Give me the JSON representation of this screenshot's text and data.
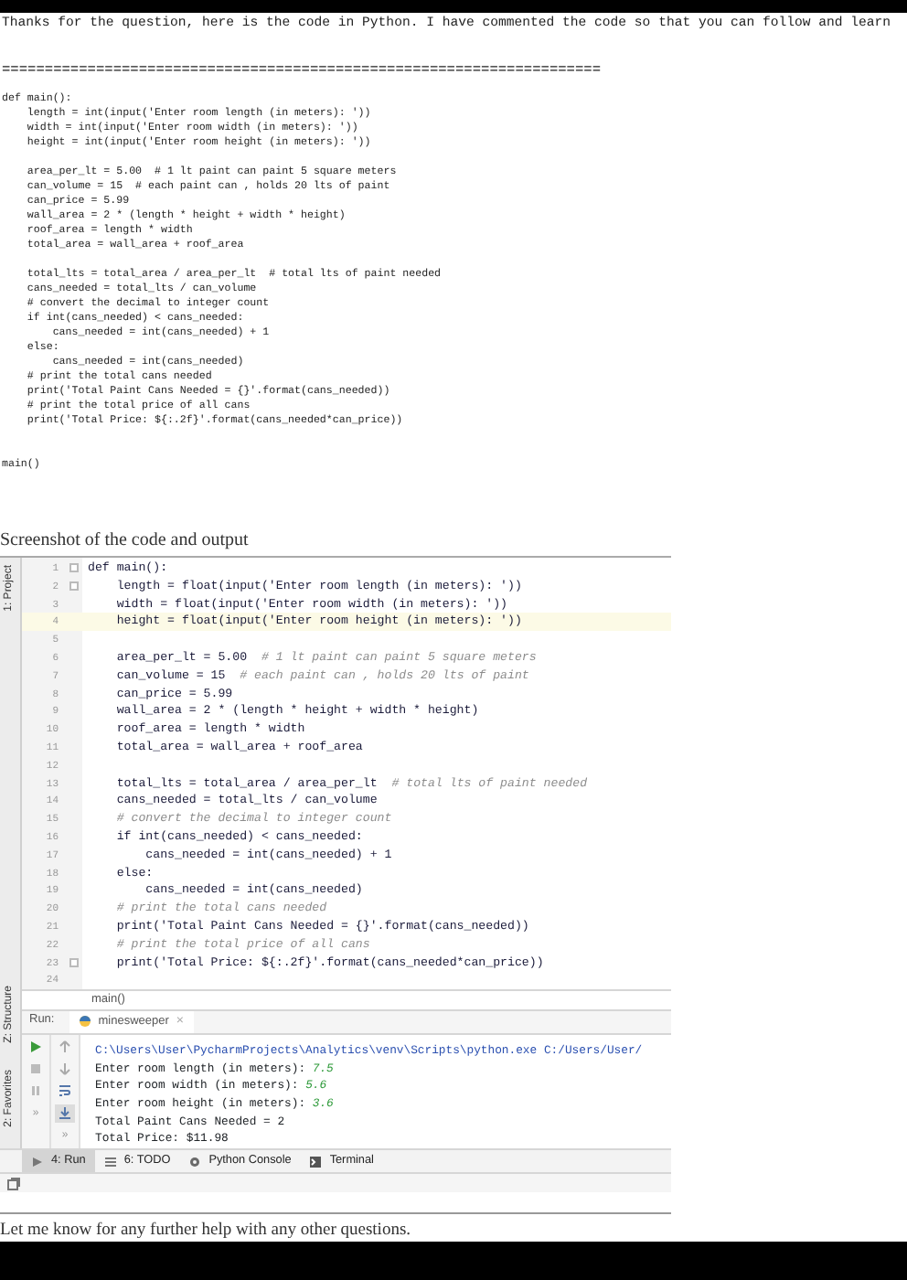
{
  "answer": {
    "intro": "Thanks for the question, here is the code in Python. I have commented the code so that you can follow and learn",
    "separator": "======================================================================",
    "code": "def main():\n    length = int(input('Enter room length (in meters): '))\n    width = int(input('Enter room width (in meters): '))\n    height = int(input('Enter room height (in meters): '))\n\n    area_per_lt = 5.00  # 1 lt paint can paint 5 square meters\n    can_volume = 15  # each paint can , holds 20 lts of paint\n    can_price = 5.99\n    wall_area = 2 * (length * height + width * height)\n    roof_area = length * width\n    total_area = wall_area + roof_area\n\n    total_lts = total_area / area_per_lt  # total lts of paint needed\n    cans_needed = total_lts / can_volume\n    # convert the decimal to integer count\n    if int(cans_needed) < cans_needed:\n        cans_needed = int(cans_needed) + 1\n    else:\n        cans_needed = int(cans_needed)\n    # print the total cans needed\n    print('Total Paint Cans Needed = {}'.format(cans_needed))\n    # print the total price of all cans\n    print('Total Price: ${:.2f}'.format(cans_needed*can_price))",
    "call": "main()"
  },
  "caption": "Screenshot of the code and output",
  "ide": {
    "tool_windows": [
      {
        "label": "1: Project",
        "kind": "top"
      },
      {
        "label": "Z: Structure",
        "kind": "bottom"
      },
      {
        "label": "2: Favorites",
        "kind": "bottom"
      }
    ],
    "editor": {
      "lines": [
        {
          "number": "1",
          "code": "def main():",
          "fold": true,
          "current": false
        },
        {
          "number": "2",
          "code": "    length = float(input('Enter room length (in meters): '))",
          "fold": true,
          "current": false
        },
        {
          "number": "3",
          "code": "    width = float(input('Enter room width (in meters): '))",
          "fold": false,
          "current": false
        },
        {
          "number": "4",
          "code": "    height = float(input('Enter room height (in meters): '))",
          "fold": false,
          "current": true
        },
        {
          "number": "5",
          "fold": false,
          "current": false
        },
        {
          "number": "6",
          "code": "    area_per_lt = 5.00  ",
          "comment": "# 1 lt paint can paint 5 square meters",
          "fold": false,
          "current": false
        },
        {
          "number": "7",
          "code": "    can_volume = 15  ",
          "comment": "# each paint can , holds 20 lts of paint",
          "fold": false,
          "current": false
        },
        {
          "number": "8",
          "code": "    can_price = 5.99",
          "fold": false,
          "current": false
        },
        {
          "number": "9",
          "code": "    wall_area = 2 * (length * height + width * height)",
          "fold": false,
          "current": false
        },
        {
          "number": "10",
          "code": "    roof_area = length * width",
          "fold": false,
          "current": false
        },
        {
          "number": "11",
          "code": "    total_area = wall_area + roof_area",
          "fold": false,
          "current": false
        },
        {
          "number": "12",
          "fold": false,
          "current": false
        },
        {
          "number": "13",
          "code": "    total_lts = total_area / area_per_lt  ",
          "comment": "# total lts of paint needed",
          "fold": false,
          "current": false
        },
        {
          "number": "14",
          "code": "    cans_needed = total_lts / can_volume",
          "fold": false,
          "current": false
        },
        {
          "number": "15",
          "comment": "    # convert the decimal to integer count",
          "fold": false,
          "current": false
        },
        {
          "number": "16",
          "code": "    if int(cans_needed) < cans_needed:",
          "fold": false,
          "current": false
        },
        {
          "number": "17",
          "code": "        cans_needed = int(cans_needed) + 1",
          "fold": false,
          "current": false
        },
        {
          "number": "18",
          "code": "    else:",
          "fold": false,
          "current": false
        },
        {
          "number": "19",
          "code": "        cans_needed = int(cans_needed)",
          "fold": false,
          "current": false
        },
        {
          "number": "20",
          "comment": "    # print the total cans needed",
          "fold": false,
          "current": false
        },
        {
          "number": "21",
          "code": "    print('Total Paint Cans Needed = {}'.format(cans_needed))",
          "fold": false,
          "current": false
        },
        {
          "number": "22",
          "comment": "    # print the total price of all cans",
          "fold": false,
          "current": false
        },
        {
          "number": "23",
          "code": "    print('Total Price: ${:.2f}'.format(cans_needed*can_price))",
          "fold": true,
          "current": false
        },
        {
          "number": "24",
          "fold": false,
          "current": false
        }
      ],
      "breadcrumb": "main()"
    },
    "run": {
      "label": "Run:",
      "tab": "minesweeper",
      "close": "×",
      "more": [
        "»",
        "»"
      ],
      "output": [
        {
          "kind": "command",
          "text": "C:\\Users\\User\\PycharmProjects\\Analytics\\venv\\Scripts\\python.exe C:/Users/User/"
        },
        {
          "kind": "prompt",
          "text": "Enter room length (in meters): ",
          "input": "7.5"
        },
        {
          "kind": "prompt",
          "text": "Enter room width (in meters): ",
          "input": "5.6"
        },
        {
          "kind": "prompt",
          "text": "Enter room height (in meters): ",
          "input": "3.6"
        },
        {
          "kind": "output",
          "text": "Total Paint Cans Needed = 2"
        },
        {
          "kind": "output",
          "text": "Total Price: $11.98"
        }
      ]
    },
    "bottom_tabs": [
      {
        "label": "4: Run",
        "kind": "run",
        "selected": true
      },
      {
        "label": "6: TODO",
        "kind": "todo",
        "selected": false
      },
      {
        "label": "Python Console",
        "kind": "console",
        "selected": false
      },
      {
        "label": "Terminal",
        "kind": "terminal",
        "selected": false
      }
    ]
  },
  "closing": "Let me know for any further help with any other questions."
}
